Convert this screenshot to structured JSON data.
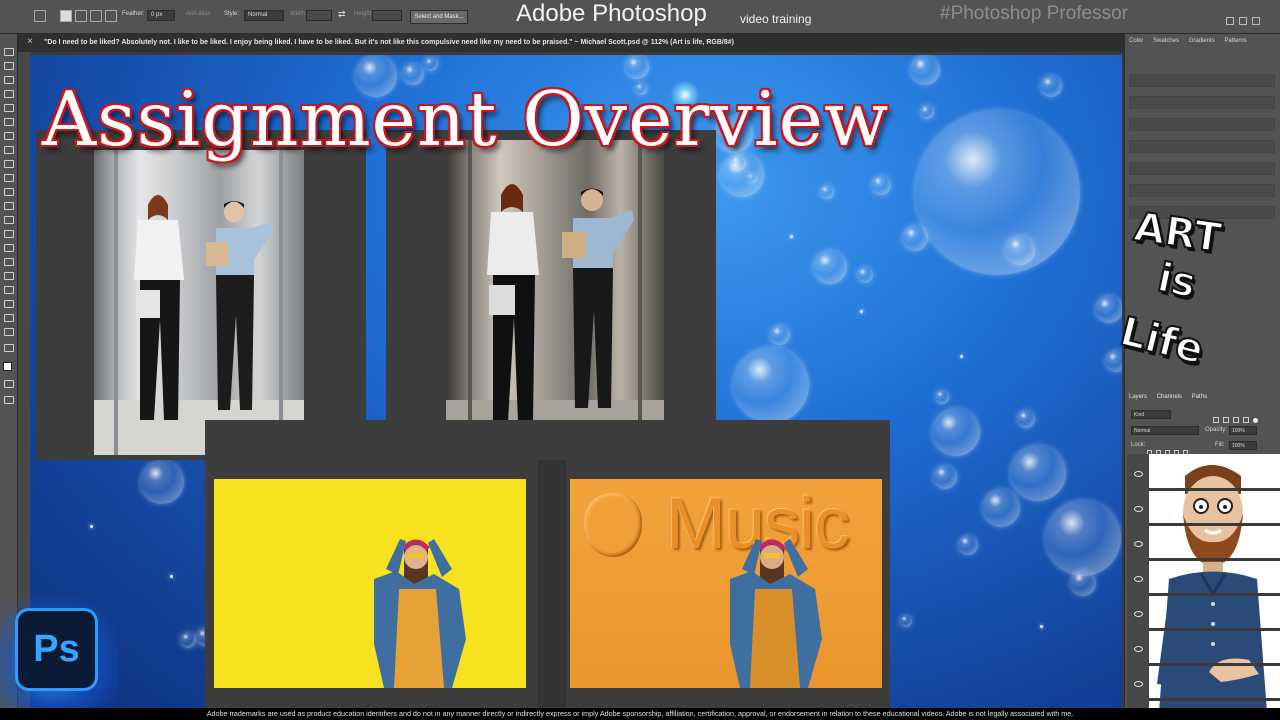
{
  "options_bar": {
    "feather_label": "Feather:",
    "feather_value": "0 px",
    "anti_alias_label": "Anti-alias",
    "style_label": "Style:",
    "style_value": "Normal",
    "width_label": "Width:",
    "height_label": "Height:",
    "select_mask_label": "Select and Mask..."
  },
  "branding": {
    "title": "Adobe Photoshop",
    "subtitle": "video training",
    "hashtag": "#Photoshop Professor"
  },
  "document_tab": {
    "title": "\"Do I need to be liked? Absolutely not. I like to be liked. I enjoy being liked. I have to be liked. But it's not like this compulsive need like my need to be praised.\" ~ Michael Scott.psd @ 112% (Art is life, RGB/8#)",
    "close_glyph": "×"
  },
  "canvas": {
    "heading": "Assignment Overview",
    "music_text": "Music"
  },
  "right_panel": {
    "tabs": [
      "Color",
      "Swatches",
      "Gradients",
      "Patterns"
    ],
    "layers_tabs": [
      "Layers",
      "Channels",
      "Paths"
    ],
    "kind_label": "Kind",
    "blend_mode": "Normal",
    "opacity_label": "Opacity:",
    "opacity_value": "100%",
    "lock_label": "Lock:",
    "fill_label": "Fill:",
    "fill_value": "100%"
  },
  "badge": {
    "line1": "ART",
    "line2": "is",
    "line3": "Life"
  },
  "ps_logo": {
    "text": "Ps"
  },
  "disclaimer": "Adobe trademarks are used as product education identifiers and do not in any manner directly or indirectly express or imply Adobe sponsorship, affiliation, certification, approval, or endorsement in relation to these educational videos. Adobe is not legally associated with me.",
  "colors": {
    "canvas_blue": "#1f6fd4",
    "title_outline": "#c8161e",
    "ps_blue": "#34a6ff",
    "yellow_wall": "#f7e21f",
    "orange_wall": "#ea962e"
  }
}
